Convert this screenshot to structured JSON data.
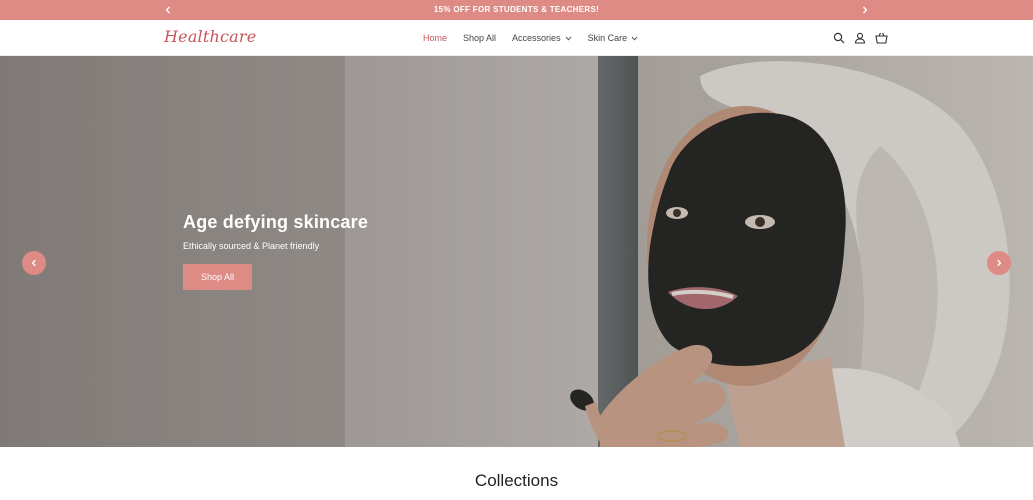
{
  "announcement": {
    "text": "15% OFF FOR STUDENTS & TEACHERS!",
    "prev_icon": "chevron-left-icon",
    "next_icon": "chevron-right-icon"
  },
  "header": {
    "logo_text": "Healthcare",
    "nav": [
      {
        "label": "Home",
        "active": true
      },
      {
        "label": "Shop All",
        "active": false
      },
      {
        "label": "Accessories",
        "active": false,
        "dropdown": true
      },
      {
        "label": "Skin Care",
        "active": false,
        "dropdown": true
      }
    ],
    "icons": [
      "search-icon",
      "account-icon",
      "cart-icon"
    ]
  },
  "hero": {
    "title": "Age defying skincare",
    "subtitle": "Ethically sourced & Planet friendly",
    "button_label": "Shop All",
    "prev_icon": "chevron-left-icon",
    "next_icon": "chevron-right-icon"
  },
  "collections": {
    "title": "Collections"
  },
  "colors": {
    "accent": "#de8a85",
    "logo": "#c8555a",
    "active_nav": "#c8555a"
  }
}
